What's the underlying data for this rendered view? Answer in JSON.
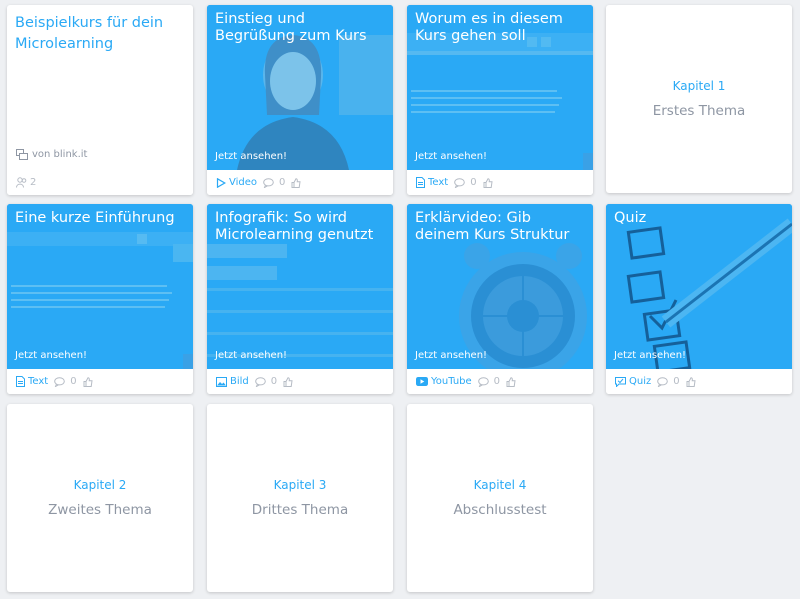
{
  "intro": {
    "title": "Beispielkurs für dein Microlearning",
    "by": "von blink.it",
    "members": "2"
  },
  "cards": [
    {
      "title": "Einstieg und Begrüßung zum Kurs",
      "cta": "Jetzt ansehen!",
      "type": "Video",
      "comments": "0",
      "icon": "play-icon"
    },
    {
      "title": "Worum es in diesem Kurs gehen soll",
      "cta": "Jetzt ansehen!",
      "type": "Text",
      "comments": "0",
      "icon": "document-icon"
    },
    {
      "title": "Eine kurze Einführung",
      "cta": "Jetzt ansehen!",
      "type": "Text",
      "comments": "0",
      "icon": "document-icon"
    },
    {
      "title": "Infografik: So wird Microlearning genutzt",
      "cta": "Jetzt ansehen!",
      "type": "Bild",
      "comments": "0",
      "icon": "image-icon"
    },
    {
      "title": "Erklärvideo: Gib deinem Kurs Struktur",
      "cta": "Jetzt ansehen!",
      "type": "YouTube",
      "comments": "0",
      "icon": "youtube-icon"
    },
    {
      "title": "Quiz",
      "cta": "Jetzt ansehen!",
      "type": "Quiz",
      "comments": "0",
      "icon": "quiz-icon"
    }
  ],
  "chapters": [
    {
      "label": "Kapitel 1",
      "title": "Erstes Thema"
    },
    {
      "label": "Kapitel 2",
      "title": "Zweites Thema"
    },
    {
      "label": "Kapitel 3",
      "title": "Drittes Thema"
    },
    {
      "label": "Kapitel 4",
      "title": "Abschlusstest"
    }
  ],
  "colors": {
    "accent": "#2aa9f5",
    "muted": "#8e96a3",
    "background": "#eef0f3"
  }
}
